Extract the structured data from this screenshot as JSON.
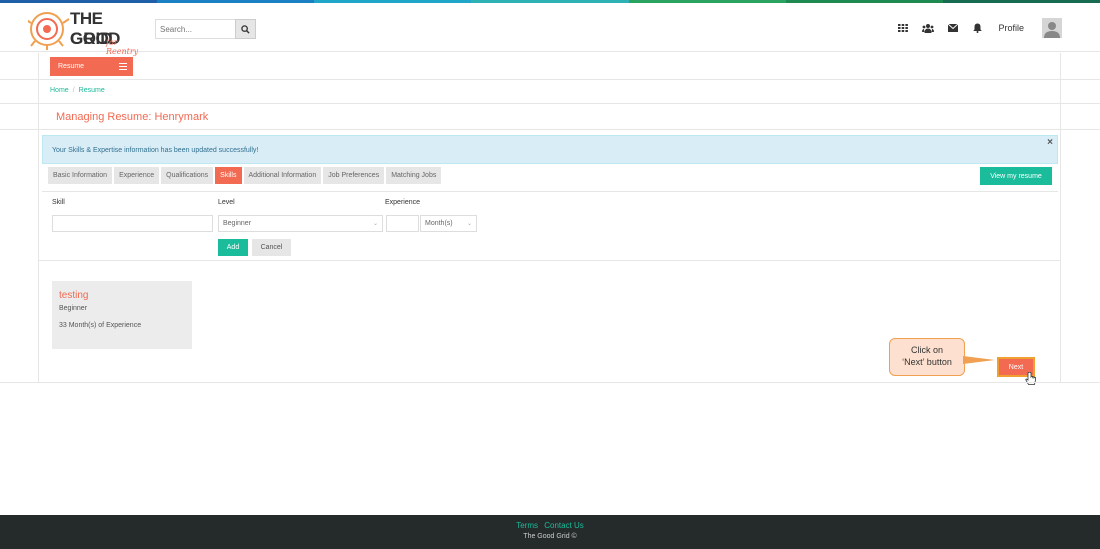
{
  "brand": {
    "logo_text_line1": "THE GOOD",
    "logo_text_line2": "GRID",
    "logo_tagline": "for Reentry",
    "strip_colors": [
      "#1f5fa8",
      "#1b7fc4",
      "#1fa6c9",
      "#2fb2b5",
      "#2aa361",
      "#1e8a4f",
      "#176b50"
    ]
  },
  "header": {
    "search_placeholder": "Search...",
    "profile_label": "Profile",
    "icons": [
      "grid-icon",
      "users-icon",
      "envelope-icon",
      "bell-icon"
    ]
  },
  "nav": {
    "resume_button": "Resume"
  },
  "breadcrumb": {
    "home": "Home",
    "separator": "/",
    "current": "Resume"
  },
  "page": {
    "title": "Managing Resume: Henrymark"
  },
  "alert": {
    "message": "Your Skills & Expertise information has been updated successfully!",
    "close": "×"
  },
  "tabs": [
    {
      "label": "Basic Information",
      "active": false
    },
    {
      "label": "Experience",
      "active": false
    },
    {
      "label": "Qualifications",
      "active": false
    },
    {
      "label": "Skills",
      "active": true
    },
    {
      "label": "Additional Information",
      "active": false
    },
    {
      "label": "Job Preferences",
      "active": false
    },
    {
      "label": "Matching Jobs",
      "active": false
    }
  ],
  "view_resume_label": "View my resume",
  "form": {
    "skill_label": "Skill",
    "skill_value": "",
    "level_label": "Level",
    "level_value": "Beginner",
    "experience_label": "Experience",
    "experience_value": "",
    "experience_unit": "Month(s)",
    "add_label": "Add",
    "cancel_label": "Cancel"
  },
  "skill_card": {
    "name": "testing",
    "level": "Beginner",
    "experience": "33 Month(s) of Experience"
  },
  "callout": {
    "line1": "Click on",
    "line2": "‘Next’ button"
  },
  "next_label": "Next",
  "footer": {
    "terms": "Terms",
    "contact": "Contact Us",
    "copyright": "The Good Grid ©"
  },
  "colors": {
    "accent": "#f26a52",
    "teal": "#1bbc9b",
    "footer_bg": "#252b2b"
  }
}
